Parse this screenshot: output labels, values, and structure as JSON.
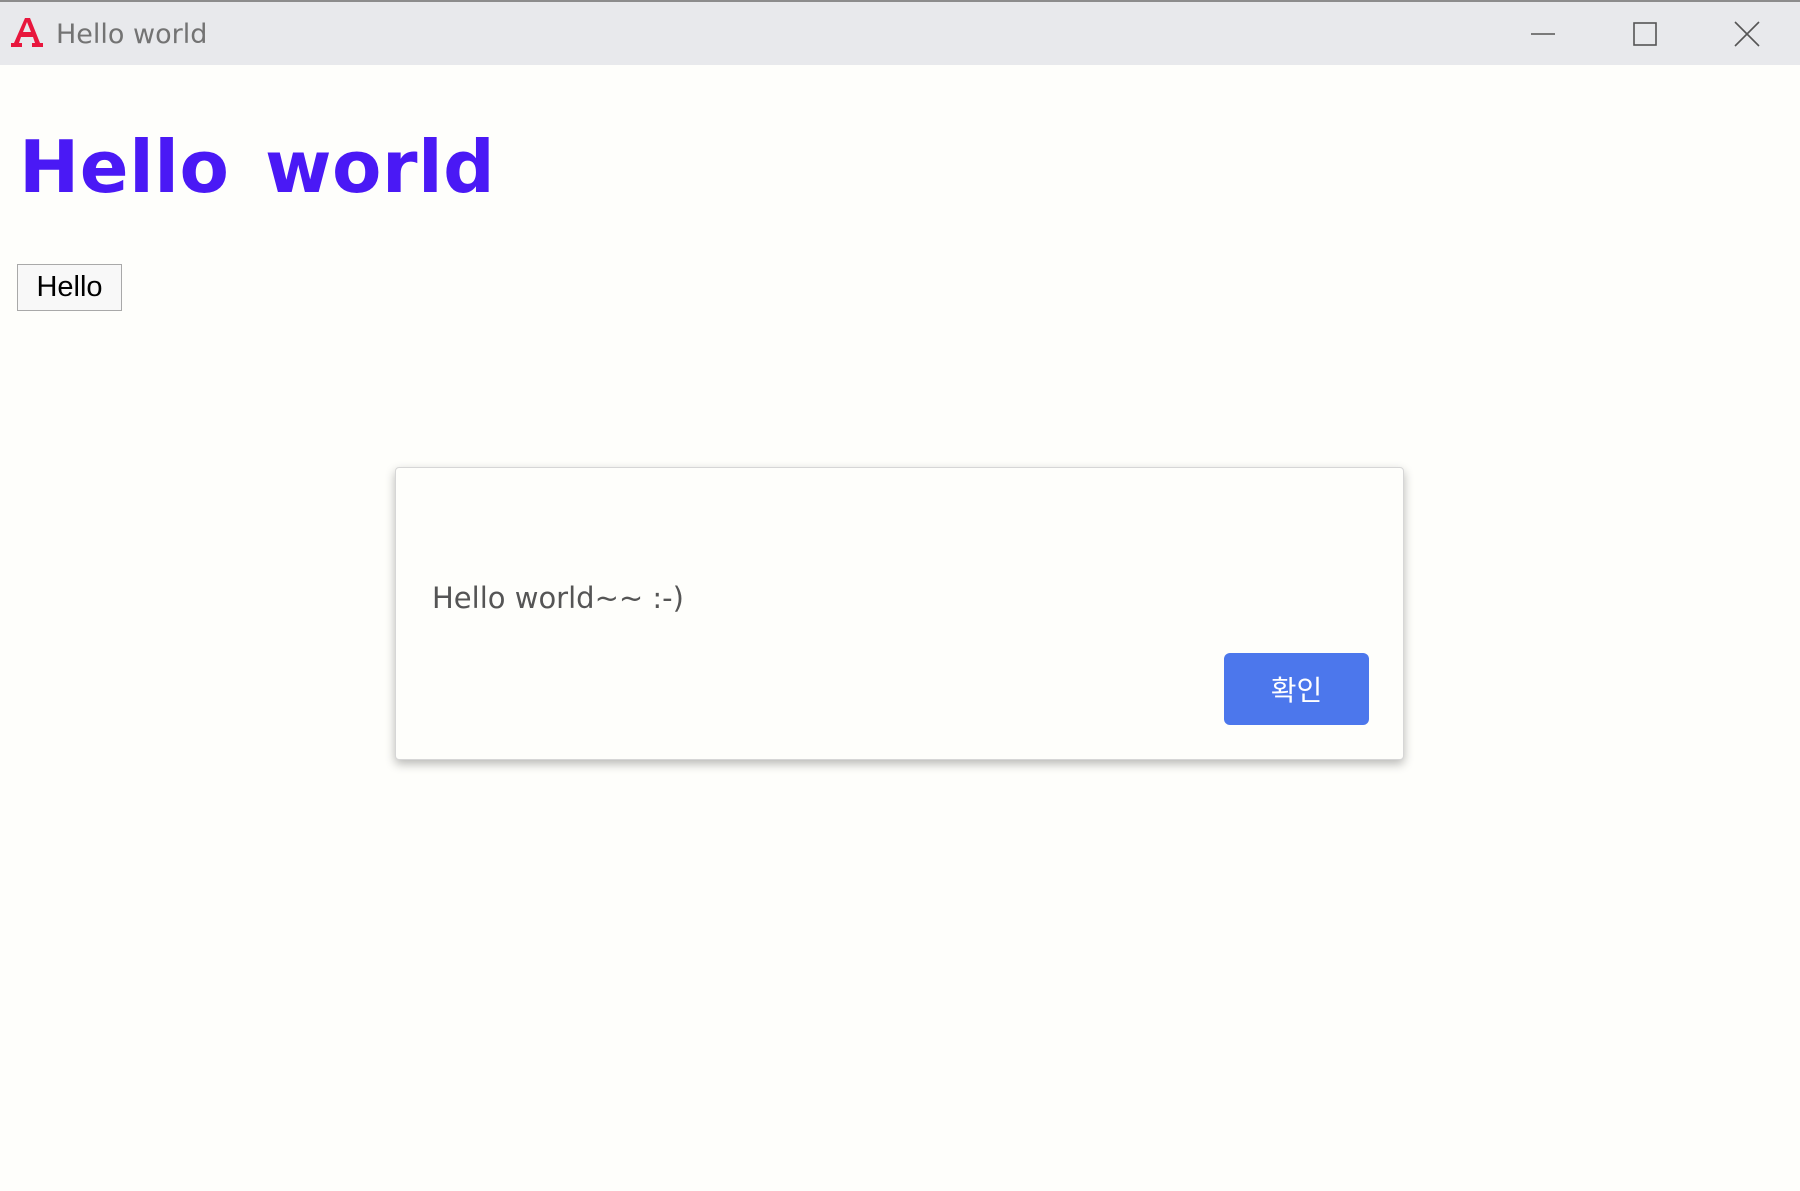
{
  "window": {
    "title": "Hello world",
    "icon": "adobe-acrobat-icon",
    "accent_icon_color": "#e8173d",
    "controls": {
      "minimize_icon": "minimize-icon",
      "maximize_icon": "maximize-icon",
      "close_icon": "close-icon"
    }
  },
  "main": {
    "heading": "Hello world",
    "heading_color": "#4a19f5",
    "button_label": "Hello"
  },
  "dialog": {
    "message": "Hello world~~ :-)",
    "confirm_label": "확인",
    "confirm_color": "#4c77ec"
  }
}
